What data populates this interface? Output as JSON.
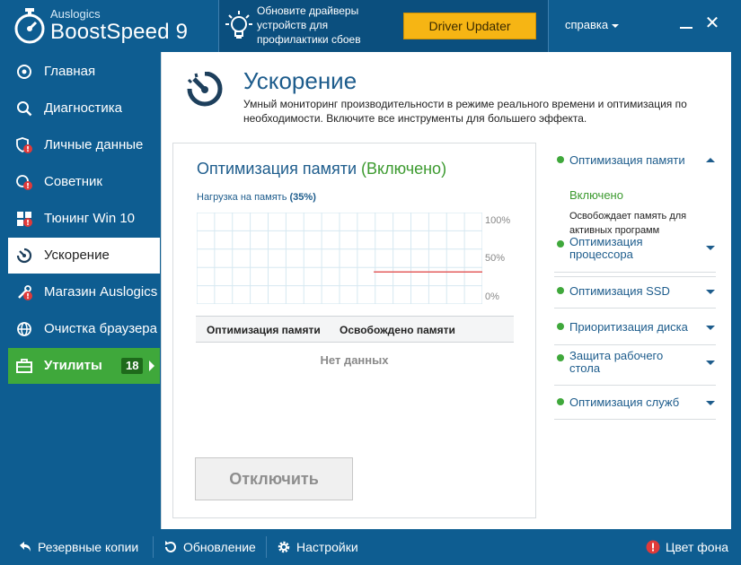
{
  "app": {
    "brand_small": "Auslogics",
    "brand_big": "BoostSpeed 9"
  },
  "promo": {
    "text": "Обновите драйверы устройств для профилактики сбоев",
    "button": "Driver Updater"
  },
  "header": {
    "help": "справка"
  },
  "sidebar": {
    "items": [
      {
        "label": "Главная",
        "icon": "home-icon"
      },
      {
        "label": "Диагностика",
        "icon": "search-icon"
      },
      {
        "label": "Личные данные",
        "icon": "privacy-shield-icon"
      },
      {
        "label": "Советник",
        "icon": "advisor-icon"
      },
      {
        "label": "Тюнинг Win 10",
        "icon": "windows-icon"
      },
      {
        "label": "Ускорение",
        "icon": "speedometer-icon"
      },
      {
        "label": "Магазин Auslogics",
        "icon": "store-icon"
      },
      {
        "label": "Очистка браузера",
        "icon": "globe-icon"
      },
      {
        "label": "Утилиты",
        "icon": "toolbox-icon",
        "badge": "18"
      }
    ],
    "active_index": 5
  },
  "main": {
    "title": "Ускорение",
    "description": "Умный мониторинг производительности в режиме реального времени и оптимизация по необходимости. Включите все инструменты для большего эффекта."
  },
  "card": {
    "title": "Оптимизация памяти",
    "status": "(Включено)",
    "load_label": "Нагрузка на память",
    "load_value": "(35%)",
    "load_percent": 35,
    "ticks": [
      "100%",
      "50%",
      "0%"
    ],
    "columns": [
      "Оптимизация памяти",
      "Освобождено памяти"
    ],
    "empty": "Нет данных",
    "disable_button": "Отключить"
  },
  "accordion": {
    "items": [
      {
        "label": "Оптимизация памяти",
        "expanded": true,
        "status": "Включено",
        "desc": "Освобождает память для активных программ"
      },
      {
        "label": "Оптимизация процессора",
        "expanded": false
      },
      {
        "label": "Оптимизация SSD",
        "expanded": false
      },
      {
        "label": "Приоритизация диска",
        "expanded": false
      },
      {
        "label": "Защита рабочего стола",
        "expanded": false
      },
      {
        "label": "Оптимизация служб",
        "expanded": false
      }
    ]
  },
  "footer": {
    "backups": "Резервные копии",
    "update": "Обновление",
    "settings": "Настройки",
    "bg_color": "Цвет фона"
  },
  "colors": {
    "brand_blue": "#0e5d91",
    "accent_green": "#3fa83b",
    "promo_yellow": "#f6b514",
    "title_blue": "#1d5c8c",
    "chart_line": "#e35d5d"
  }
}
